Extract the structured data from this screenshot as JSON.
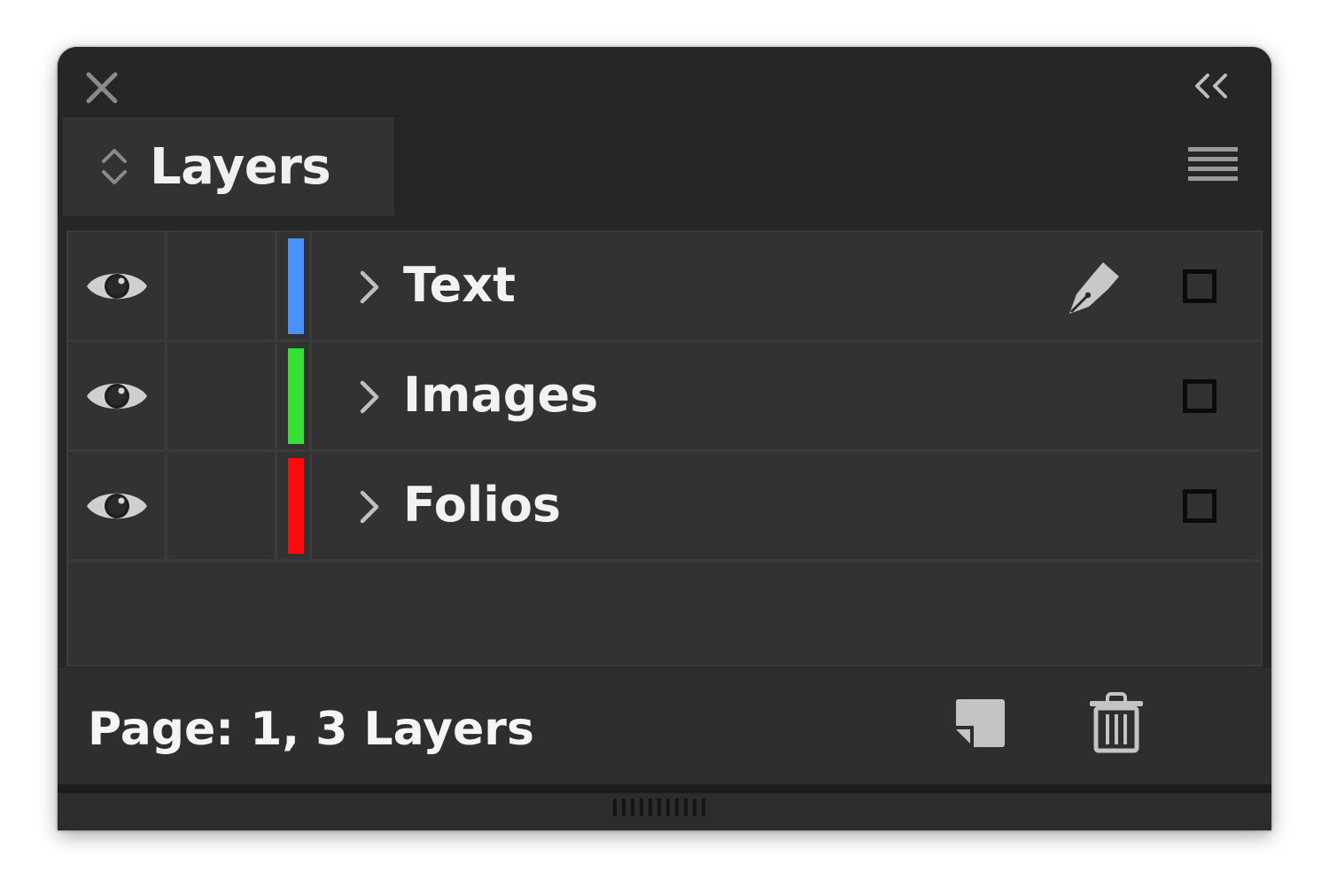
{
  "panel": {
    "close_icon": "close-icon",
    "collapse_icon": "double-chevron-left-icon",
    "menu_icon": "hamburger-menu-icon"
  },
  "tab": {
    "label": "Layers",
    "arrows_icon": "up-down-chevron-icon"
  },
  "layers": [
    {
      "name": "Text",
      "color": "#4a90ff",
      "visible": true,
      "expanded": false,
      "active_pen": true,
      "selected_target": false
    },
    {
      "name": "Images",
      "color": "#33e033",
      "visible": true,
      "expanded": false,
      "active_pen": false,
      "selected_target": false
    },
    {
      "name": "Folios",
      "color": "#ff0a0a",
      "visible": true,
      "expanded": false,
      "active_pen": false,
      "selected_target": false
    }
  ],
  "footer": {
    "status": "Page: 1, 3 Layers",
    "new_layer_icon": "new-layer-icon",
    "delete_icon": "trash-icon"
  }
}
